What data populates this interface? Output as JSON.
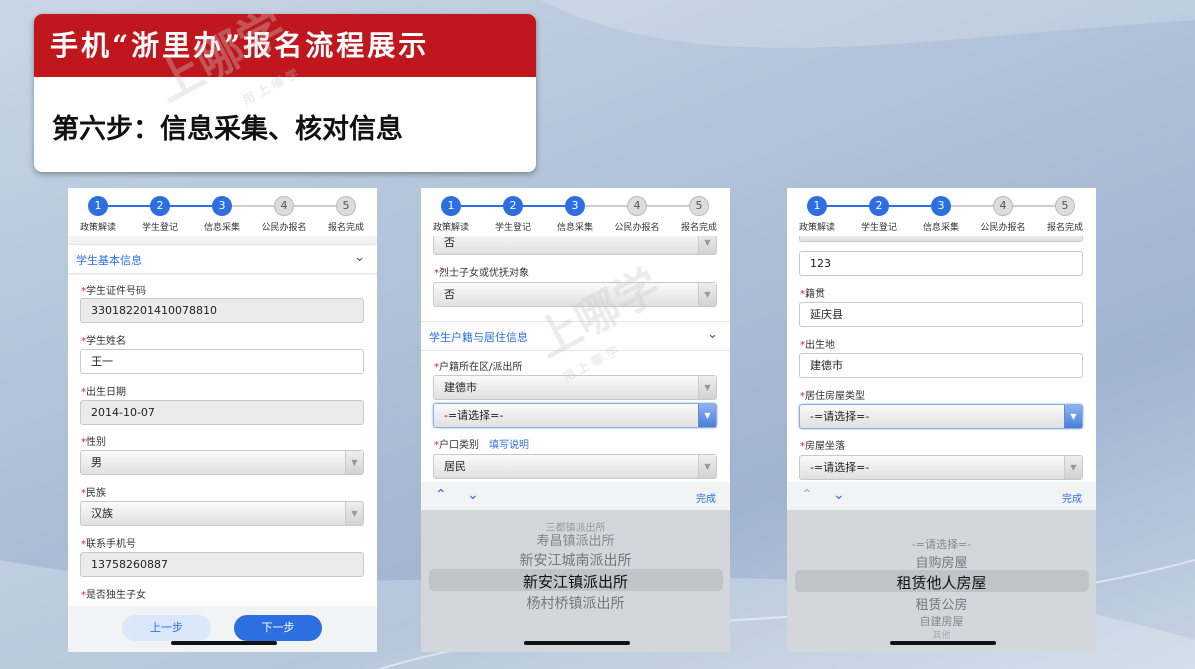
{
  "title": {
    "heading": "手机“浙里办”报名流程展示",
    "subheading": "第六步：信息采集、核对信息"
  },
  "watermark": {
    "brand": "上哪学",
    "tagline": "用 上 哪 学"
  },
  "steps": [
    {
      "num": "1",
      "label": "政策解读",
      "state": "done"
    },
    {
      "num": "2",
      "label": "学生登记",
      "state": "done"
    },
    {
      "num": "3",
      "label": "信息采集",
      "state": "done"
    },
    {
      "num": "4",
      "label": "公民办报名",
      "state": "todo"
    },
    {
      "num": "5",
      "label": "报名完成",
      "state": "todo"
    }
  ],
  "screen1": {
    "section_title": "学生基本信息",
    "id_label": "学生证件号码",
    "id_value": "330182201410078810",
    "name_label": "学生姓名",
    "name_value": "王一",
    "birth_label": "出生日期",
    "birth_value": "2014-10-07",
    "gender_label": "性别",
    "gender_value": "男",
    "ethnic_label": "民族",
    "ethnic_value": "汉族",
    "phone_label": "联系手机号",
    "phone_value": "13758260887",
    "only_child_label": "是否独生子女",
    "prev_button": "上一步",
    "next_button": "下一步"
  },
  "screen2": {
    "top_value": "否",
    "martyr_label": "烈士子女或优抚对象",
    "martyr_value": "否",
    "section_title": "学生户籍与居住信息",
    "huji_label": "户籍所在区/派出所",
    "huji_district": "建德市",
    "huji_station": "-=请选择=-",
    "hukou_label": "户口类别",
    "hukou_link": "填写说明",
    "hukou_value": "居民",
    "done_label": "完成",
    "picker_items": [
      "三都镇派出所",
      "寿昌镇派出所",
      "新安江城南派出所",
      "新安江镇派出所",
      "杨村桥镇派出所"
    ]
  },
  "screen3": {
    "top_value": "123",
    "jiguan_label": "籍贯",
    "jiguan_value": "延庆县",
    "birthplace_label": "出生地",
    "birthplace_value": "建德市",
    "house_type_label": "居住房屋类型",
    "house_type_value": "-=请选择=-",
    "house_loc_label": "房屋坐落",
    "house_loc_value": "-=请选择=-",
    "done_label": "完成",
    "picker_items": [
      "-=请选择=-",
      "自购房屋",
      "租赁他人房屋",
      "租赁公房",
      "自建房屋",
      "其他"
    ]
  },
  "colors": {
    "brand_red": "#c0161d",
    "accent_blue": "#2d6fe0"
  },
  "icons": {
    "chevron": "chevron-down-icon",
    "up": "chevron-up-icon",
    "down": "chevron-down-icon"
  }
}
